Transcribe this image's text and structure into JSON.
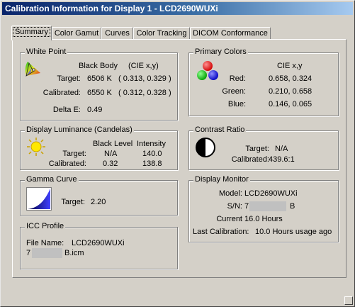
{
  "window": {
    "title": "Calibration Information for Display 1 - LCD2690WUXi"
  },
  "tabs": [
    {
      "label": "Summary"
    },
    {
      "label": "Color Gamut"
    },
    {
      "label": "Curves"
    },
    {
      "label": "Color Tracking"
    },
    {
      "label": "DICOM Conformance"
    }
  ],
  "white_point": {
    "title": "White Point",
    "col_black_body": "Black Body",
    "col_cie": "(CIE x,y)",
    "target_label": "Target:",
    "target_k": "6506 K",
    "target_xy": "( 0.313, 0.329 )",
    "calibrated_label": "Calibrated:",
    "calibrated_k": "6550 K",
    "calibrated_xy": "( 0.312, 0.328 )",
    "delta_label": "Delta E:",
    "delta_value": "0.49"
  },
  "primary_colors": {
    "title": "Primary Colors",
    "col_cie": "CIE x,y",
    "red_label": "Red:",
    "red_value": "0.658, 0.324",
    "green_label": "Green:",
    "green_value": "0.210, 0.658",
    "blue_label": "Blue:",
    "blue_value": "0.146, 0.065"
  },
  "display_luminance": {
    "title": "Display Luminance (Candelas)",
    "col_black": "Black Level",
    "col_intensity": "Intensity",
    "target_label": "Target:",
    "target_black": "N/A",
    "target_intensity": "140.0",
    "calibrated_label": "Calibrated:",
    "calibrated_black": "0.32",
    "calibrated_intensity": "138.8"
  },
  "contrast_ratio": {
    "title": "Contrast Ratio",
    "target_label": "Target:",
    "target_value": "N/A",
    "calibrated_label": "Calibrated:",
    "calibrated_value": "439.6:1"
  },
  "gamma_curve": {
    "title": "Gamma Curve",
    "target_label": "Target:",
    "target_value": "2.20"
  },
  "display_monitor": {
    "title": "Display Monitor",
    "model_label": "Model:",
    "model_value": "LCD2690WUXi",
    "sn_label": "S/N:",
    "sn_start": "7",
    "sn_end": "B",
    "current_label": "Current",
    "current_value": "16.0 Hours",
    "lastcal_label": "Last Calibration:",
    "lastcal_value": "10.0 Hours usage ago"
  },
  "icc_profile": {
    "title": "ICC Profile",
    "file_label": "File Name:",
    "file_value": "LCD2690WUXi",
    "file_line2_start": "7",
    "file_line2_end": "B.icm"
  },
  "colors": {
    "title_dark": "#0a246a",
    "title_light": "#a6caf0",
    "face": "#d4d0c8",
    "redaction": "#c0c0c0"
  }
}
